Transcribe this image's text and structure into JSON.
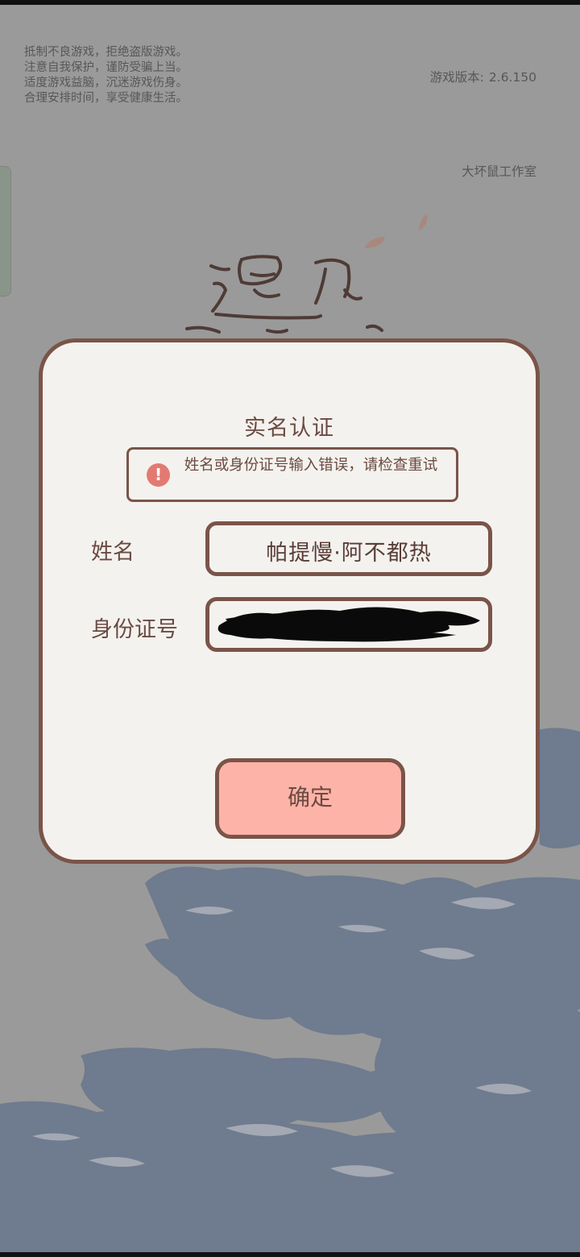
{
  "notice": {
    "lines": [
      "抵制不良游戏，拒绝盗版游戏。",
      "注意自我保护，谨防受骗上当。",
      "适度游戏益脑，沉迷游戏伤身。",
      "合理安排时间，享受健康生活。"
    ]
  },
  "version": {
    "label": "游戏版本:",
    "value": "2.6.150"
  },
  "studio": "大坏鼠工作室",
  "dialog": {
    "title": "实名认证",
    "error_message": "姓名或身份证号输入错误，请检查重试",
    "name_label": "姓名",
    "name_value": "帕提慢·阿不都热",
    "id_label": "身份证号",
    "id_value_redacted": true,
    "confirm_label": "确定"
  },
  "colors": {
    "overlay": "#9a9a9a",
    "dialog_bg": "#f4f2ee",
    "border_brown": "#7a5449",
    "text_brown": "#6b4a42",
    "button_pink": "#fdb3a8",
    "error_red": "#e27a72",
    "water_blue": "#6f7b8e"
  },
  "icons": {
    "error": "exclamation-circle-icon"
  }
}
